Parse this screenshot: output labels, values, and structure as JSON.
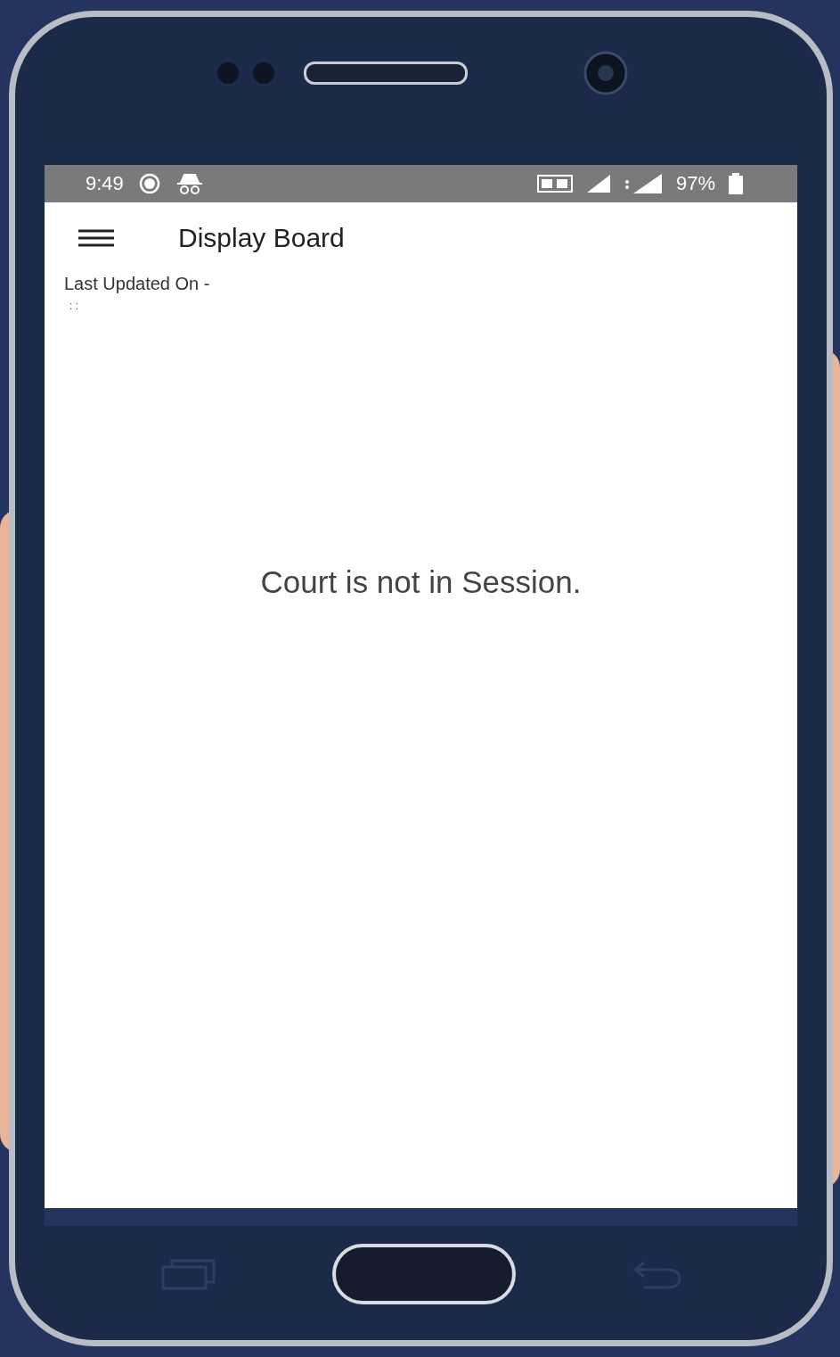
{
  "status_bar": {
    "time": "9:49",
    "battery": "97%"
  },
  "app_bar": {
    "title": "Display Board"
  },
  "last_updated": {
    "label": "Last Updated On -",
    "value": ": :"
  },
  "message": "Court is not in Session."
}
